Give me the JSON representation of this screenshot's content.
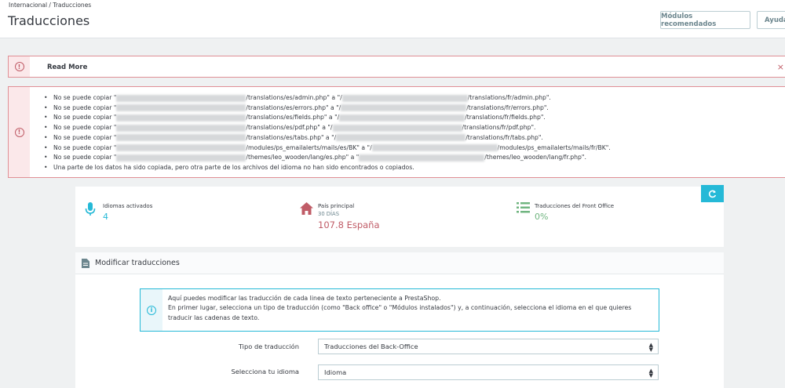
{
  "header": {
    "breadcrumb": "Internacional  /  Traducciones",
    "title": "Traducciones",
    "buttons": {
      "modules": "Módulos recomendados",
      "help": "Ayuda"
    }
  },
  "alert_readmore": {
    "text": "Read More",
    "close": "×"
  },
  "alert_errors": {
    "items": [
      {
        "pre": "No se puede copiar \"",
        "mid": "/translations/es/admin.php\" a \"/",
        "post": "/translations/fr/admin.php\"."
      },
      {
        "pre": "No se puede copiar \"",
        "mid": "/translations/es/errors.php\" a \"/",
        "post": "/translations/fr/errors.php\"."
      },
      {
        "pre": "No se puede copiar \"",
        "mid": "/translations/es/fields.php\" a \"/",
        "post": "/translations/fr/fields.php\"."
      },
      {
        "pre": "No se puede copiar \"",
        "mid": "/translations/es/pdf.php\" a \"/",
        "post": "/translations/fr/pdf.php\"."
      },
      {
        "pre": "No se puede copiar \"",
        "mid": "/translations/es/tabs.php\" a \"/",
        "post": "/translations/fr/tabs.php\"."
      },
      {
        "pre": "No se puede copiar \"",
        "mid": "/modules/ps_emailalerts/mails/es/BK\" a \"/",
        "post": "/modules/ps_emailalerts/mails/fr/BK\"."
      },
      {
        "pre": "No se puede copiar \"",
        "mid": "/themes/leo_wooden/lang/es.php\" a \"",
        "post": "/themes/leo_wooden/lang/fr.php\"."
      }
    ],
    "footer": "Una parte de los datos ha sido copiada, pero otra parte de los archivos del idioma no han sido encontrados o copiados."
  },
  "kpis": {
    "languages": {
      "label": "Idiomas activados",
      "value": "4"
    },
    "country": {
      "label": "País principal",
      "sub": "30 DÍAS",
      "value": "107.8 España"
    },
    "front": {
      "label": "Traducciones del Front Office",
      "value": "0%"
    }
  },
  "colors": {
    "accent": "#25b9d7",
    "danger": "#c05c67",
    "kpi_blue": "#25b9d7",
    "kpi_red": "#c05c67",
    "kpi_green": "#70b580"
  },
  "modify": {
    "title": "Modificar traducciones",
    "info": [
      "Aquí puedes modificar las traducción de cada linea de texto perteneciente a PrestaShop.",
      "En primer lugar, selecciona un tipo de traducción (como \"Back office\" o \"Módulos instalados\") y, a continuación, selecciona el idioma en el que quieres traducir las cadenas de texto."
    ],
    "type_label": "Tipo de traducción",
    "type_value": "Traducciones del Back-Office",
    "lang_label": "Selecciona tu idioma",
    "lang_value": "Idioma"
  }
}
